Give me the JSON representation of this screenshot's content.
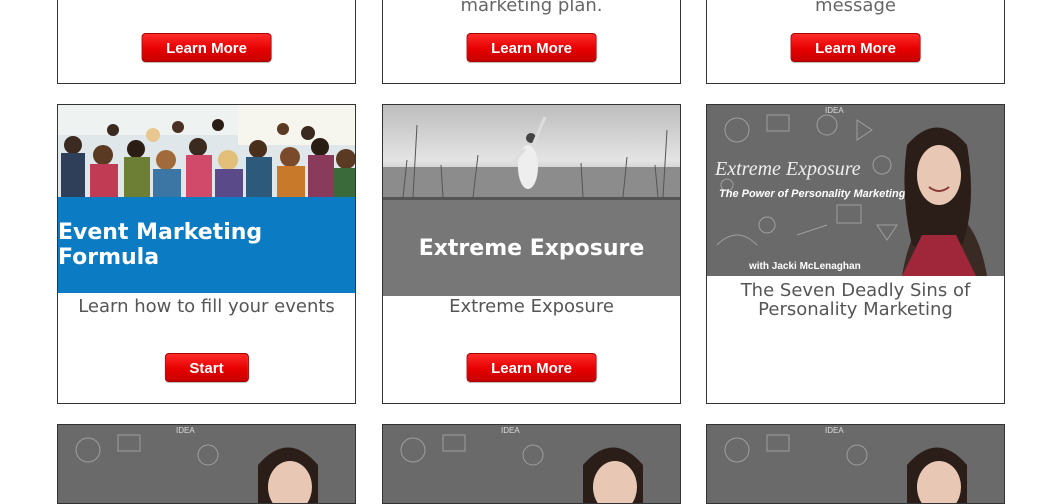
{
  "row0": [
    {
      "text": "",
      "button": "Learn More"
    },
    {
      "text": "marketing plan.",
      "button": "Learn More"
    },
    {
      "text": "message",
      "button": "Learn More"
    }
  ],
  "row1": [
    {
      "banner": "Event Marketing Formula",
      "subtitle": "Learn how to fill your events",
      "button": "Start",
      "banner_color": "#0b7cc3"
    },
    {
      "banner": "Extreme Exposure",
      "subtitle": "Extreme Exposure",
      "button": "Learn More",
      "banner_color": "#777777"
    },
    {
      "image_title": "Extreme Exposure",
      "image_tagline": "The Power of Personality Marketing",
      "image_byline": "with Jacki McLenaghan",
      "subtitle_line1": "The Seven Deadly Sins of",
      "subtitle_line2": "Personality Marketing"
    }
  ],
  "row2": [
    {
      "image": "chalkboard-portrait"
    },
    {
      "image": "chalkboard-portrait"
    },
    {
      "image": "chalkboard-portrait"
    }
  ],
  "colors": {
    "button_red": "#e60000",
    "banner_blue": "#0b7cc3",
    "banner_gray": "#777777"
  }
}
